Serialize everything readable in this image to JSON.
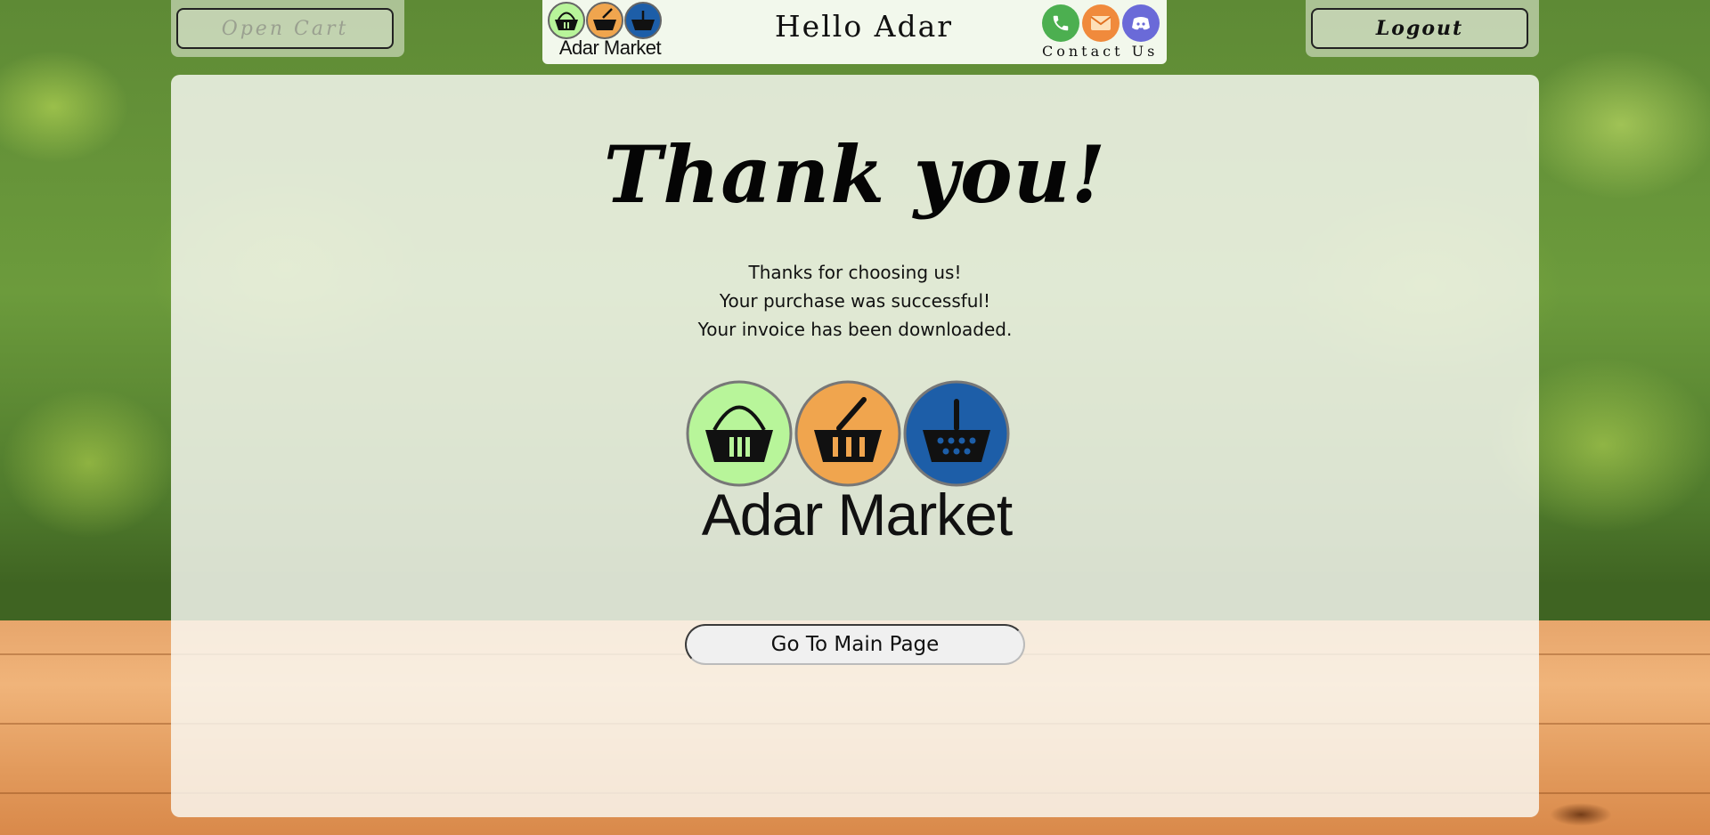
{
  "header": {
    "open_cart_label": "Open Cart",
    "logout_label": "Logout",
    "greeting": "Hello Adar",
    "contact_label": "Contact Us",
    "logo_text": "Adar Market",
    "contact_icons": [
      "phone-icon",
      "mail-icon",
      "discord-icon"
    ]
  },
  "main": {
    "title": "Thank you!",
    "messages": [
      "Thanks for choosing us!",
      "Your purchase was successful!",
      "Your invoice has been downloaded."
    ],
    "logo_text": "Adar Market",
    "main_page_button": "Go To Main Page"
  },
  "colors": {
    "basket_green": "#b8f59a",
    "basket_orange": "#f0a54e",
    "basket_blue": "#1d5ea8",
    "phone": "#4caf50",
    "mail": "#f08a3c",
    "discord": "#6a6ad8"
  }
}
